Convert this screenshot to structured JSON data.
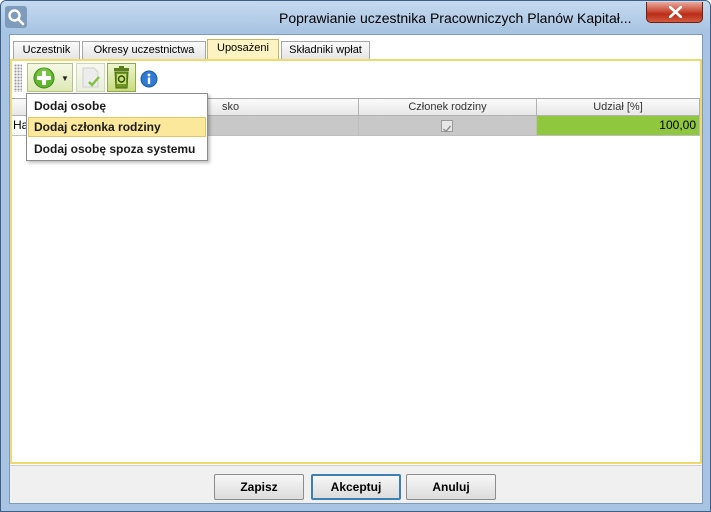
{
  "window": {
    "title": "Poprawianie uczestnika Pracowniczych Planów Kapitał..."
  },
  "tabs": [
    {
      "label": "Uczestnik",
      "active": false
    },
    {
      "label": "Okresy uczestnictwa",
      "active": false
    },
    {
      "label": "Uposażeni",
      "active": true
    },
    {
      "label": "Składniki wpłat",
      "active": false
    }
  ],
  "toolbar": {
    "icons": [
      "add-icon",
      "accept-icon",
      "delete-icon",
      "info-icon"
    ]
  },
  "grid": {
    "columns": [
      "",
      "sko",
      "Członek rodziny",
      "Udział [%]"
    ],
    "rows": [
      {
        "name": "Ha",
        "family_member": true,
        "share": "100,00"
      }
    ]
  },
  "menu": {
    "items": [
      {
        "label": "Dodaj osobę"
      },
      {
        "label": "Dodaj członka rodziny"
      },
      {
        "label": "Dodaj osobę spoza systemu"
      }
    ],
    "hovered_index": 1
  },
  "buttons": {
    "save": "Zapisz",
    "accept": "Akceptuj",
    "cancel": "Anuluj"
  },
  "colors": {
    "accent_tab": "#fdf2c2",
    "share_cell": "#8fc73e",
    "menu_hover": "#fbe89a"
  }
}
